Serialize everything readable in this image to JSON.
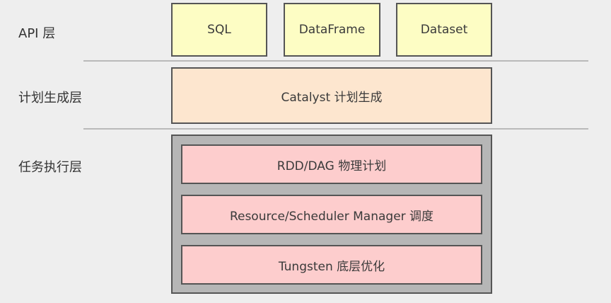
{
  "layers": {
    "api": {
      "label": "API 层",
      "boxes": [
        "SQL",
        "DataFrame",
        "Dataset"
      ]
    },
    "plan": {
      "label": "计划生成层",
      "box": "Catalyst 计划生成"
    },
    "exec": {
      "label": "任务执行层",
      "boxes": [
        "RDD/DAG 物理计划",
        "Resource/Scheduler Manager 调度",
        "Tungsten 底层优化"
      ]
    }
  },
  "colors": {
    "background": "#eeeeee",
    "api_fill": "#fdfdc4",
    "plan_fill": "#fde6cf",
    "exec_container_fill": "#b6b6b6",
    "exec_fill": "#fdcdcd",
    "border": "#555555",
    "divider": "#b9b9b9"
  }
}
